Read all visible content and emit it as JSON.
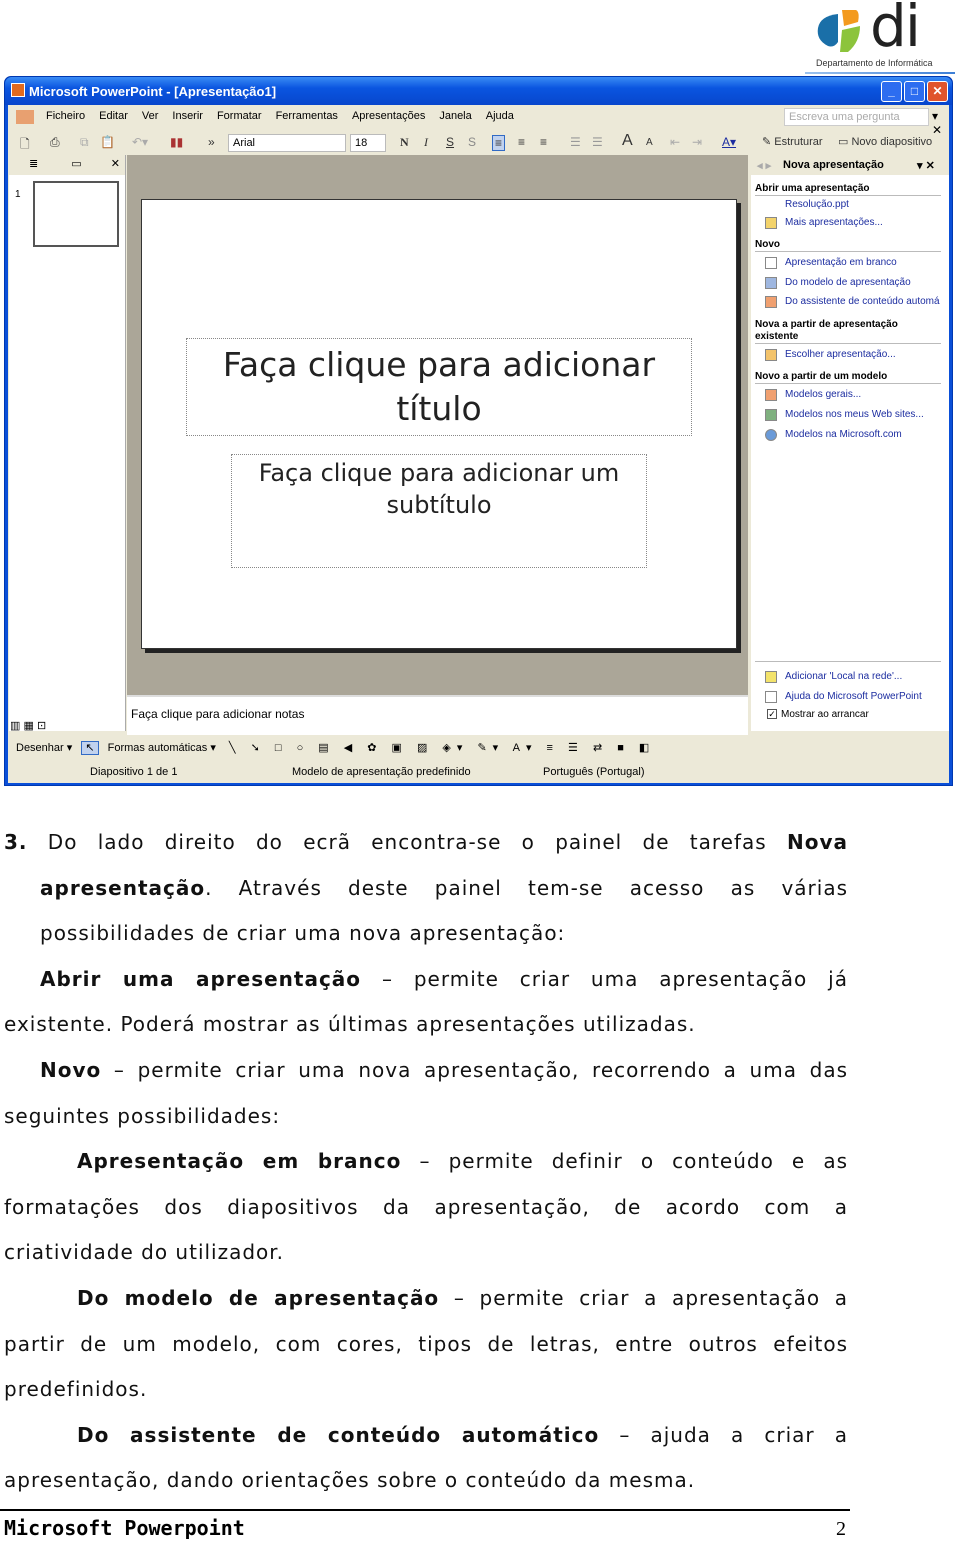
{
  "logo": {
    "text": "di",
    "subtitle": "Departamento de Informática",
    "colors": [
      "#1a6fa8",
      "#f39a1e",
      "#8cc43c"
    ]
  },
  "window": {
    "title": "Microsoft PowerPoint - [Apresentação1]",
    "controls": [
      "minimize",
      "maximize",
      "close"
    ],
    "menu": [
      "Ficheiro",
      "Editar",
      "Ver",
      "Inserir",
      "Formatar",
      "Ferramentas",
      "Apresentações",
      "Janela",
      "Ajuda"
    ],
    "ask_placeholder": "Escreva uma pergunta",
    "toolbar": {
      "font": "Arial",
      "size": "18",
      "bold": "N",
      "italic": "I",
      "underline": "S",
      "shadow": "S",
      "design": "Estruturar",
      "new_slide": "Novo diapositivo"
    },
    "slide_number": "1",
    "slide": {
      "title_placeholder": "Faça clique para adicionar título",
      "subtitle_placeholder": "Faça clique para adicionar um subtítulo"
    },
    "notes_placeholder": "Faça clique para adicionar notas",
    "task_pane": {
      "title": "Nova apresentação",
      "sections": [
        {
          "heading": "Abrir uma apresentação",
          "items": [
            "Resolução.ppt",
            "Mais apresentações..."
          ]
        },
        {
          "heading": "Novo",
          "items": [
            "Apresentação em branco",
            "Do modelo de apresentação",
            "Do assistente de conteúdo automá"
          ]
        },
        {
          "heading": "Nova a partir de apresentação existente",
          "items": [
            "Escolher apresentação..."
          ]
        },
        {
          "heading": "Novo a partir de um modelo",
          "items": [
            "Modelos gerais...",
            "Modelos nos meus Web sites...",
            "Modelos na Microsoft.com"
          ]
        }
      ],
      "footer_items": [
        "Adicionar 'Local na rede'...",
        "Ajuda do Microsoft PowerPoint"
      ],
      "show_on_startup": {
        "label": "Mostrar ao arrancar",
        "checked": true
      }
    },
    "drawing": {
      "draw": "Desenhar",
      "autoshapes": "Formas automáticas"
    },
    "status": {
      "slide": "Diapositivo 1 de 1",
      "template": "Modelo de apresentação predefinido",
      "language": "Português (Portugal)"
    }
  },
  "doc": {
    "p1": {
      "num": "3.",
      "a": " Do lado direito do ecrã encontra-se o painel de tarefas ",
      "b": "Nova apresentação",
      "c": ". Através deste painel tem-se acesso as várias possibilidades de criar uma nova apresentação:"
    },
    "p2": {
      "b": "Abrir uma apresentação",
      "c": " – permite criar uma apresentação já existente. Poderá mostrar as últimas apresentações utilizadas."
    },
    "p3": {
      "b": "Novo",
      "c": " – permite criar uma nova apresentação, recorrendo a uma das seguintes possibilidades:"
    },
    "p4": {
      "b": "Apresentação em branco",
      "c": " – permite definir o conteúdo e as formatações dos diapositivos da apresentação, de acordo com a criatividade do utilizador."
    },
    "p5": {
      "b": "Do modelo de apresentação",
      "c": " – permite criar a apresentação a partir de um modelo, com cores, tipos de letras, entre outros efeitos predefinidos."
    },
    "p6": {
      "b": "Do assistente de conteúdo automático",
      "c": " – ajuda a criar a apresentação, dando orientações sobre o conteúdo da mesma."
    }
  },
  "footer": {
    "title": "Microsoft Powerpoint",
    "page": "2"
  }
}
